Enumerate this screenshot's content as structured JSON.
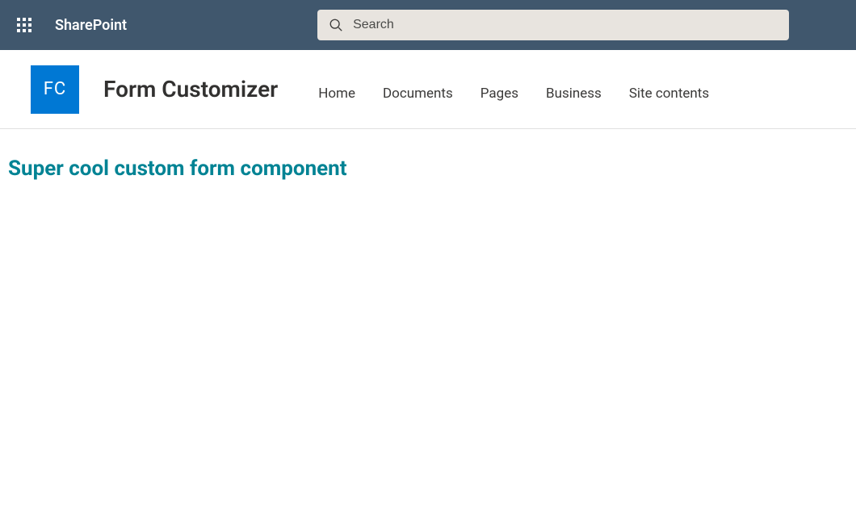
{
  "suite": {
    "app_name": "SharePoint",
    "search_placeholder": "Search"
  },
  "site": {
    "logo_text": "FC",
    "title": "Form Customizer",
    "nav": [
      {
        "label": "Home"
      },
      {
        "label": "Documents"
      },
      {
        "label": "Pages"
      },
      {
        "label": "Business"
      },
      {
        "label": "Site contents"
      }
    ]
  },
  "content": {
    "heading": "Super cool custom form component"
  },
  "colors": {
    "suite_bar": "#40576d",
    "brand_blue": "#0078d4",
    "heading_teal": "#008394"
  }
}
